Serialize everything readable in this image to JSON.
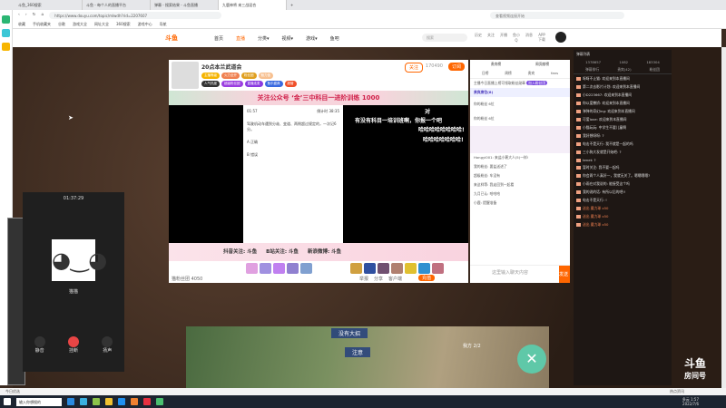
{
  "browser": {
    "tabs": [
      "斗鱼_360搜索",
      "斗鱼 - 每个人的直播平台",
      "弹幕 - 搜索结果 - 斗鱼直播",
      "九鹿神将 来三战混合"
    ],
    "url": "https://www.douyu.com/topic/mlwdh?rid=2207607",
    "search_placeholder": "查看视频连接开始",
    "bookmarks": [
      "收藏",
      "手机收藏夹",
      "谷歌",
      "游戏大全",
      "网址大全",
      "360搜索",
      "游戏中心",
      "导航"
    ]
  },
  "nav": {
    "logo": "斗鱼",
    "items": [
      "首页",
      "直播",
      "分类▾",
      "视频▾",
      "游戏▾",
      "鱼吧"
    ],
    "search_placeholder": "搜索",
    "icons": [
      "历史",
      "关注",
      "开播",
      "鱼小Q",
      "消息",
      "APP下载"
    ]
  },
  "stream": {
    "title": "20点本兰武道会",
    "tags": [
      "主播等级",
      "火力全开",
      "粉丝团",
      "魅力值"
    ],
    "follow": "关注",
    "follow_count": "170490",
    "subscribe": "订阅",
    "badges": [
      "人气热度",
      "超级粉丝团",
      "直播连麦",
      "鱼乐盛典",
      "超管"
    ],
    "banner": "关注公众号 ‘金’三中科目一进阶训练 1000",
    "phone": {
      "time": "01:57",
      "timer": "倒计时 38:35",
      "question": "驾驶机动车遇到分歧、变道、两侧超过规定的，一次记6分。",
      "options": [
        "A 正确",
        "B 错误"
      ]
    },
    "danmaku": [
      "对",
      "有没有科目一培训班啊，你报一个吧",
      "哈哈哈哈哈哈哈哈!",
      "哈哈哈哈哈哈哈!"
    ],
    "socials": [
      "抖音关注: 斗鱼",
      "B站关注: 斗鱼",
      "新浪微博: 斗鱼"
    ],
    "footer": [
      "猫粉丝团 4050",
      "举报",
      "分享",
      "客户端",
      "充值"
    ],
    "send": "发送"
  },
  "rightpanel": {
    "tabs": [
      "日榜",
      "周榜",
      "贵宾",
      "fans"
    ],
    "rank_tabs": [
      "贵宾榜",
      "周贡献榜"
    ],
    "notice": "主播今日直播上榜可领取粉丝勋章",
    "join": "加入粉丝团",
    "vip_title": "贵宾席位(8)",
    "users": [
      "你的粉丝 6位",
      "你的粉丝 6位"
    ],
    "chats": [
      "Hongyi001: 来盐小薯大人(5)一样!",
      "我的粉丝: 要盐送进了",
      "超级粉丝: 车没有",
      "来这样等: 我走回到一起看",
      "九月已认: 哈哈哈",
      "小鹿: 提醒准备"
    ],
    "input_placeholder": "这里输入聊天内容"
  },
  "danmu": {
    "title": "弹幕列表",
    "counts": [
      "1378657",
      "1082",
      "183304"
    ],
    "tabs": [
      "弹幕排行",
      "贵宾(42)",
      "粉丝团"
    ],
    "rows": [
      "呀呀不止猫: 欢迎来到本直播间",
      "第二次去影片计划: 欢迎来到本直播间",
      "小D223667: 欢迎来到本直播间",
      "你以爱撒娇: 欢迎来到本直播间",
      "弹弹的奇幻ing: 欢迎来到本直播间",
      "可爱love: 欢迎来到本直播间",
      "小猫玩玩: 中学生不要儿童啊",
      "我好想呀呀: ?",
      "电击不是天行: 我不就是一起的吗",
      "三小狗大发就是开始吧: ?",
      "tenet: ?",
      "暂时关注: 我不要一起吗",
      "你会两个人真好一，我就无关了。嗯嗯嗯嗯?",
      "小雨在对我说的: 能接受这个吗",
      "我的说的话: 有所以后的吧!!",
      "电击不是天行: !",
      "送出 魔力球 x50",
      "送出 魔力球 x50",
      "送出 魔力球 x50"
    ]
  },
  "call": {
    "timer": "01:37:29",
    "name": "猫猫",
    "buttons": [
      "静音",
      "挂断",
      "扬声"
    ]
  },
  "game": {
    "labels": [
      "没有大招",
      "注意",
      "我方 2/2"
    ]
  },
  "watermark": {
    "brand": "斗鱼",
    "sub": "房间号"
  },
  "taskbar": {
    "search": "输入你想搜的",
    "time": "1:57",
    "date": "2022/7/6",
    "weather": "多云",
    "status_left": "今日优选",
    "status_right": "热点资讯"
  }
}
